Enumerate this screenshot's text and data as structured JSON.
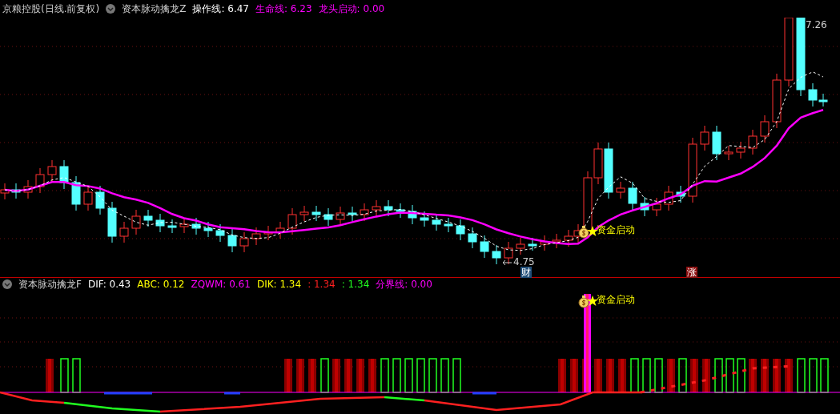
{
  "main_panel": {
    "stock_title": "京粮控股(日线.前复权)",
    "indicator_name": "资本脉动擒龙Z",
    "values": [
      {
        "label": "操作线: 6.47",
        "color": "#ffffff"
      },
      {
        "label": "生命线: 6.23",
        "color": "#ff00ff"
      },
      {
        "label": "龙头启动: 0.00",
        "color": "#ff00ff"
      }
    ],
    "high_label": "7.26",
    "low_label": "4.75",
    "signal_label": "资金启动",
    "markers": [
      {
        "text": "财",
        "color": "#1f4e79"
      },
      {
        "text": "涨",
        "color": "#8b1010"
      }
    ]
  },
  "sub_panel": {
    "indicator_name": "资本脉动擒龙F",
    "values": [
      {
        "label": "DIF: 0.43",
        "color": "#ffffff"
      },
      {
        "label": "ABC: 0.12",
        "color": "#ffff00"
      },
      {
        "label": "ZQWM: 0.61",
        "color": "#ff00ff"
      },
      {
        "label": "DIK: 1.34",
        "color": "#ffff00"
      },
      {
        "label": ": 1.34",
        "color": "#ff2020"
      },
      {
        "label": ": 1.34",
        "color": "#20ff20"
      },
      {
        "label": "分界线: 0.00",
        "color": "#ff00ff"
      }
    ],
    "signal_label": "资金启动"
  }
}
